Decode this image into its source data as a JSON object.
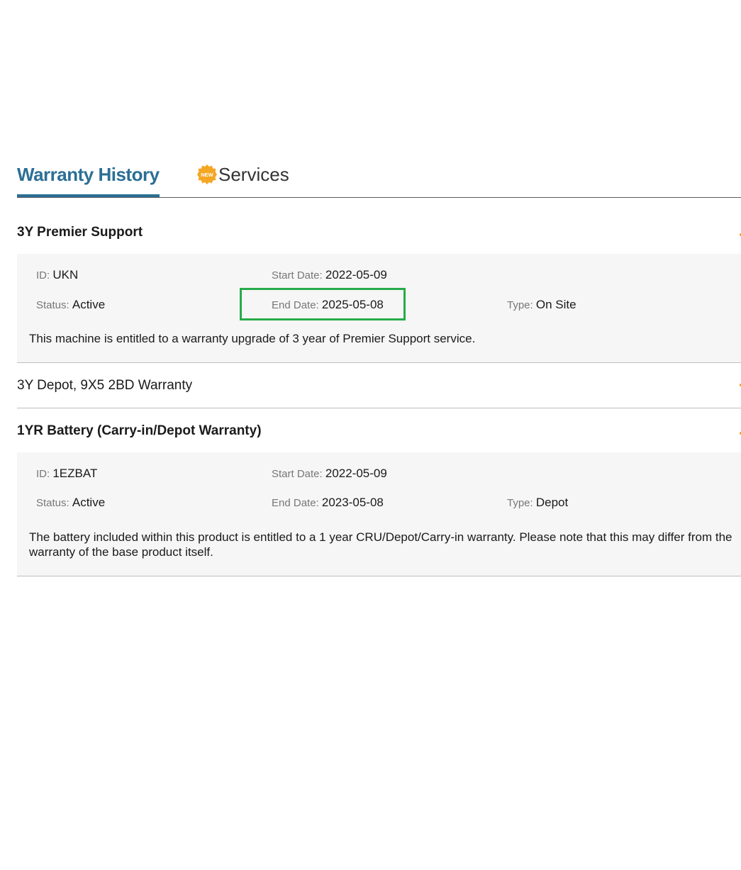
{
  "tabs": [
    {
      "label": "Warranty History",
      "active": true
    },
    {
      "label": "Services",
      "badge": "NEW",
      "active": false
    }
  ],
  "colors": {
    "accent": "#2b6f95",
    "badge": "#f5a623",
    "highlight": "#27ab4a",
    "panel_bg": "#f6f6f6"
  },
  "warranties": [
    {
      "title": "3Y Premier Support",
      "expanded": true,
      "id_label": "ID",
      "id_value": "UKN",
      "status_label": "Status",
      "status_value": "Active",
      "start_label": "Start Date",
      "start_value": "2022-05-09",
      "end_label": "End Date",
      "end_value": "2025-05-08",
      "type_label": "Type",
      "type_value": "On Site",
      "description": "This machine is entitled to a warranty upgrade of 3 year of Premier Support service."
    },
    {
      "title": "3Y Depot, 9X5 2BD Warranty",
      "expanded": false
    },
    {
      "title": "1YR Battery (Carry-in/Depot Warranty)",
      "expanded": true,
      "id_label": "ID",
      "id_value": "1EZBAT",
      "status_label": "Status",
      "status_value": "Active",
      "start_label": "Start Date",
      "start_value": "2022-05-09",
      "end_label": "End Date",
      "end_value": "2023-05-08",
      "type_label": "Type",
      "type_value": "Depot",
      "description": "The battery included within this product is entitled to a 1 year CRU/Depot/Carry-in warranty. Please note that this may differ from the warranty of the base product itself."
    }
  ],
  "separator": ": "
}
